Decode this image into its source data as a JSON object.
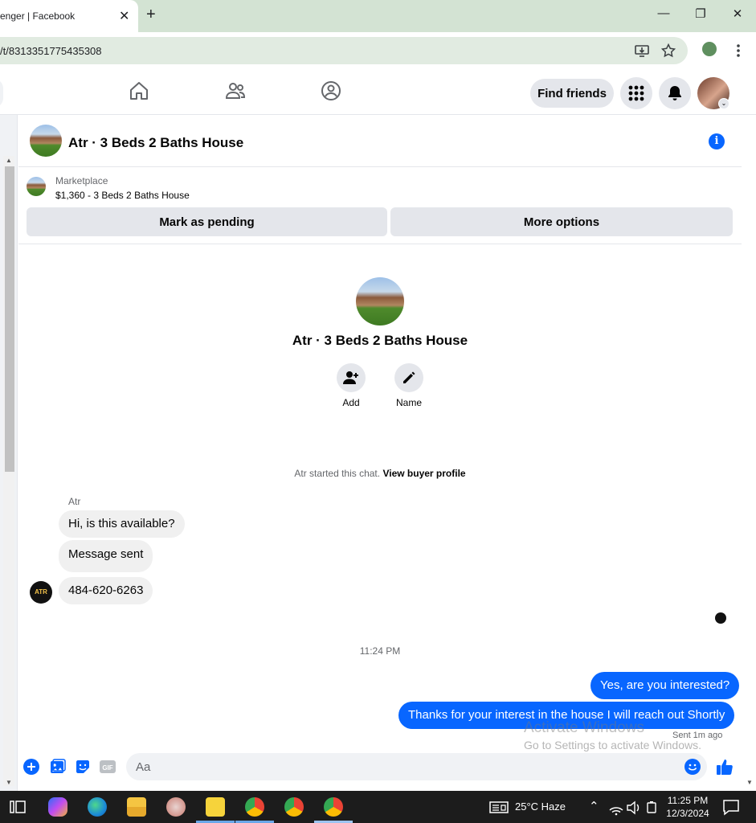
{
  "browser": {
    "tab_title": "enger | Facebook",
    "tab_close": "✕",
    "new_tab": "+",
    "url": "/t/8313351775435308",
    "window_minimize": "—",
    "window_restore": "❐",
    "window_close": "✕"
  },
  "header": {
    "find_friends": "Find friends"
  },
  "chat": {
    "title": "Atr · 3 Beds 2 Baths House",
    "marketplace": {
      "label": "Marketplace",
      "listing": "$1,360 - 3 Beds 2 Baths House",
      "mark_pending": "Mark as pending",
      "more_options": "More options"
    },
    "profile": {
      "name": "Atr · 3 Beds 2 Baths House",
      "add_label": "Add",
      "name_label": "Name"
    },
    "started_text": "Atr started this chat.",
    "view_buyer_profile": "View buyer profile",
    "sender_name": "Atr",
    "sender_avatar_text": "ATR",
    "incoming": [
      "Hi, is this available?",
      "Message sent",
      "484-620-6263"
    ],
    "timestamp": "11:24 PM",
    "outgoing": [
      "Yes, are you interested?",
      "Thanks for your interest in the house I will reach out Shortly"
    ],
    "sent_status": "Sent 1m ago",
    "composer_placeholder": "Aa"
  },
  "watermark": {
    "line1": "Activate Windows",
    "line2": "Go to Settings to activate Windows."
  },
  "taskbar": {
    "weather": "25°C  Haze",
    "time": "11:25 PM",
    "date": "12/3/2024"
  },
  "colors": {
    "messenger_blue": "#0866ff",
    "bubble_gray": "#f0f0f0",
    "chrome_green": "#d3e3d3"
  }
}
